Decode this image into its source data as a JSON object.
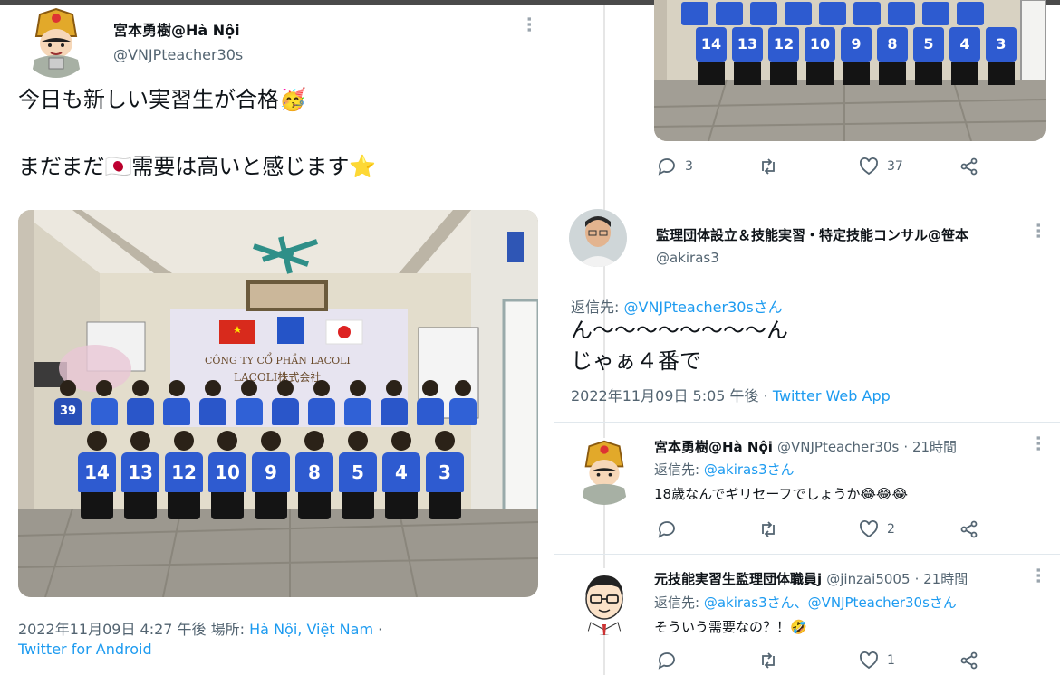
{
  "main_tweet": {
    "author_name": "宮本勇樹@Hà Nội",
    "author_handle": "@VNJPteacher30s",
    "line1": "今日も新しい実習生が合格🥳",
    "line2": "まだまだ🇯🇵需要は高いと感じます⭐",
    "photo": {
      "banner_company": "CÔNG TY CỔ PHẦN LACOLI",
      "banner_sub": "LACOLI株式会社",
      "jersey_numbers": [
        "14",
        "13",
        "12",
        "10",
        "9",
        "8",
        "5",
        "4",
        "3",
        "39"
      ]
    },
    "timestamp": "2022年11月09日 4:27 午後",
    "location_label": "場所:",
    "location": "Hà Nội, Việt Nam",
    "separator": "·",
    "client": "Twitter for Android",
    "icons": [
      "avatar-illustration",
      "more-dots-icon"
    ]
  },
  "right_top": {
    "jersey_numbers": [
      "14",
      "13",
      "12",
      "10",
      "9",
      "8",
      "5",
      "4",
      "3"
    ],
    "replies": "3",
    "retweets": "",
    "likes": "37"
  },
  "reply_main": {
    "author_name": "監理団体設立＆技能実習・特定技能コンサル@笹本",
    "author_handle": "@akiras3",
    "reply_to_label": "返信先:",
    "reply_to_user": "@VNJPteacher30sさん",
    "line1": "ん〜〜〜〜〜〜〜〜ん",
    "line2": "じゃぁ４番で",
    "timestamp": "2022年11月09日 5:05 午後",
    "separator": "·",
    "client": "Twitter Web App"
  },
  "reply_2": {
    "author_name": "宮本勇樹@Hà Nội",
    "author_handle": "@VNJPteacher30s",
    "time": "· 21時間",
    "reply_to_label": "返信先:",
    "reply_to_user": "@akiras3さん",
    "text": "18歳なんでギリセーフでしょうか😂😂😂",
    "replies": "",
    "retweets": "",
    "likes": "2"
  },
  "reply_3": {
    "author_name": "元技能実習生監理団体職員j",
    "author_handle": "@jinzai5005",
    "time": "· 21時間",
    "reply_to_label": "返信先:",
    "reply_to_user": "@akiras3さん、@VNJPteacher30sさん",
    "text": "そういう需要なの？！🤣",
    "replies": "",
    "retweets": "",
    "likes": "1"
  },
  "colors": {
    "link": "#1d9bf0",
    "muted": "#536471",
    "jersey": "#2e5bd0"
  }
}
